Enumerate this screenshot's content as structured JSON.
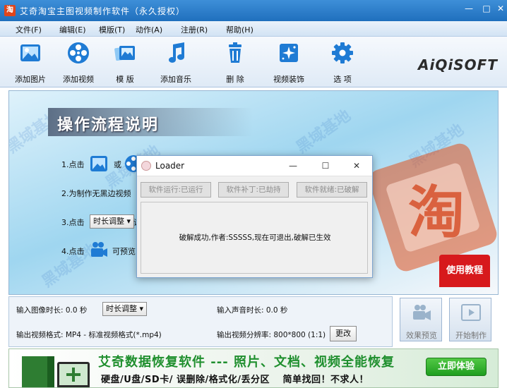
{
  "window": {
    "title": "艾奇淘宝主图视频制作软件（永久授权）",
    "min": "—",
    "max": "□",
    "close": "✕"
  },
  "menu": [
    "文件(F)",
    "编辑(E)",
    "模版(T)",
    "动作(A)",
    "注册(R)",
    "帮助(H)"
  ],
  "toolbar": {
    "add_image": "添加图片",
    "add_video": "添加视频",
    "template": "模 版",
    "add_music": "添加音乐",
    "delete": "删 除",
    "video_decor": "视频装饰",
    "options": "选 项"
  },
  "brand": "AiQiSOFT",
  "flow": {
    "title": "操作流程说明",
    "step1_prefix": "1.点击",
    "step1_or": "或",
    "step2": "2.为制作无黑边视频",
    "step3_prefix": "3.点击",
    "step3_btn": "时长调整",
    "step3_suffix": "设",
    "step4_prefix": "4.点击",
    "step4_suffix": "可预览",
    "tutorial": "使用教程"
  },
  "loader": {
    "title": "Loader",
    "btn_running": "软件运行:已运行",
    "btn_patch": "软件补丁:已劫持",
    "btn_ready": "软件就绪:已破解",
    "message": "破解成功,作者:SSSSS,现在可退出,破解已生效",
    "min": "—",
    "max": "☐",
    "close": "✕"
  },
  "settings": {
    "image_duration_label": "输入图像时长: 0.0 秒",
    "duration_button": "时长调整",
    "audio_duration_label": "输入声音时长: 0.0 秒",
    "output_format_label": "输出视频格式: MP4 - 标准视频格式(*.mp4)",
    "output_resolution_label": "输出视频分辨率: 800*800 (1:1)",
    "change_button": "更改"
  },
  "actions": {
    "preview": "效果预览",
    "start": "开始制作"
  },
  "ad": {
    "headline": "艾奇数据恢复软件 --- 照片、文档、视频全能恢复",
    "sub": "硬盘/U盘/SD卡/ 误删除/格式化/丢分区　 简单找回！不求人！",
    "cta": "立即体验"
  },
  "watermark": "黑域基地"
}
